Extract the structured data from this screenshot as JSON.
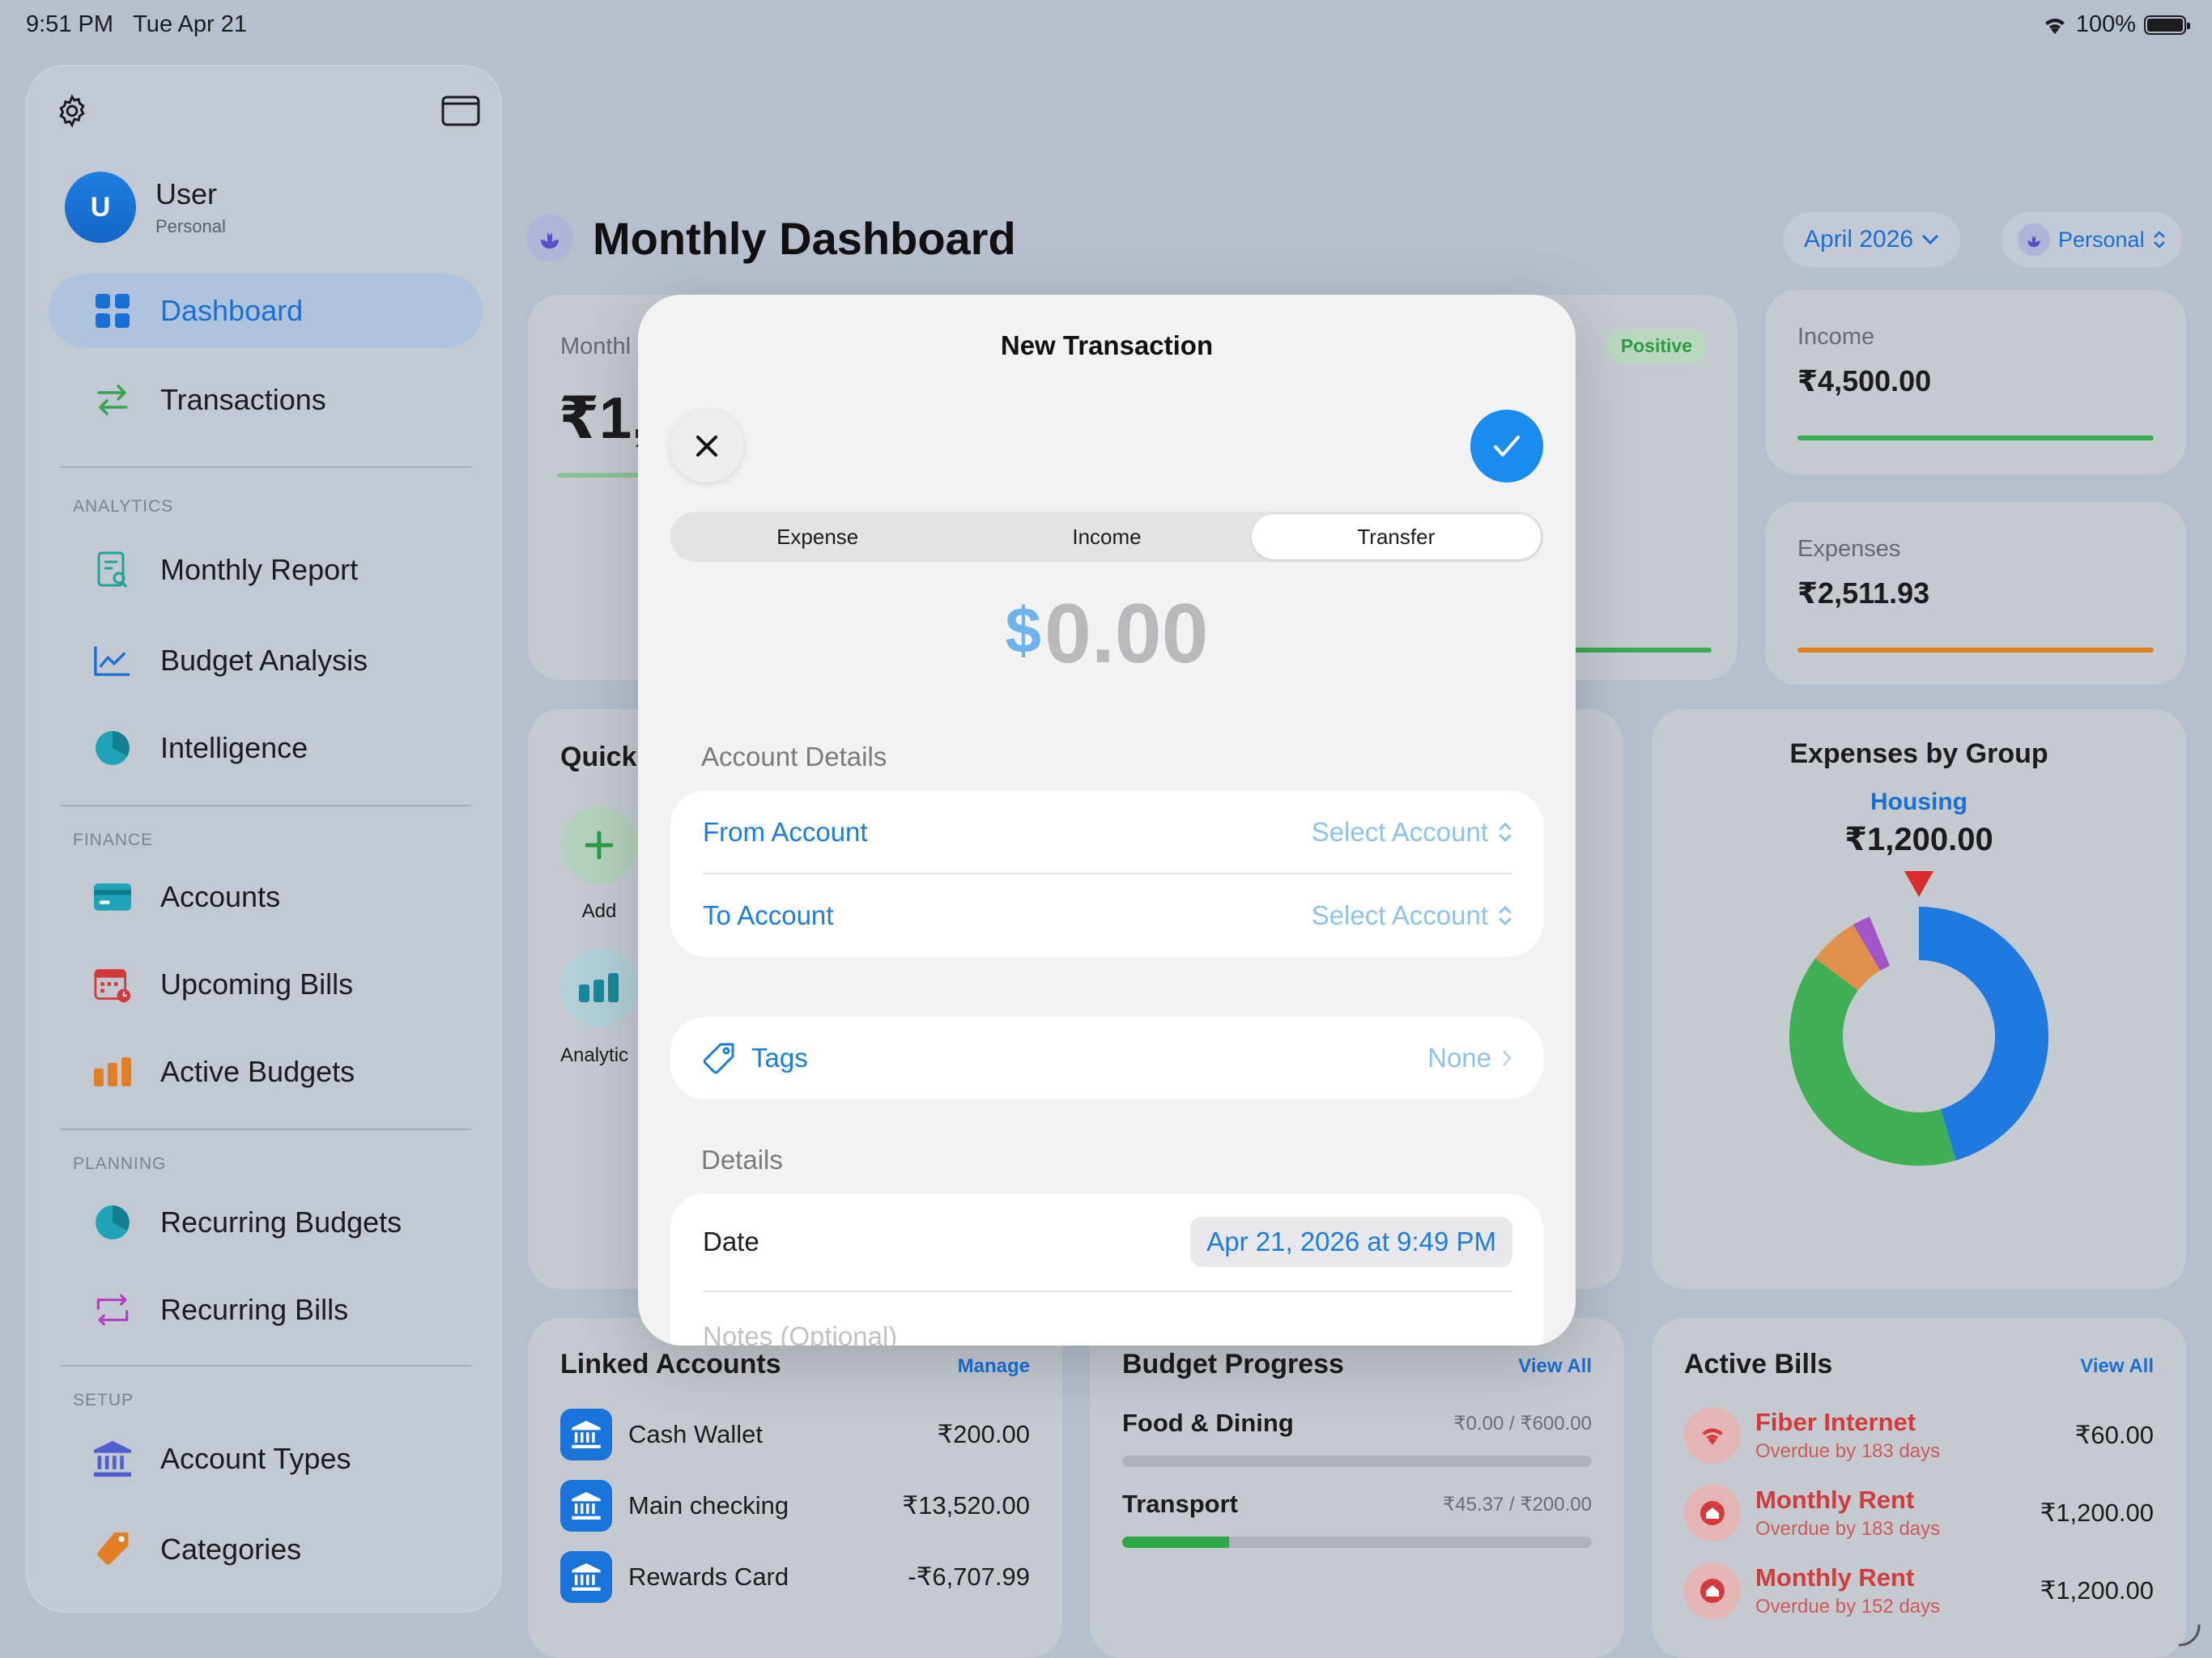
{
  "status_bar": {
    "time": "9:51 PM",
    "date": "Tue Apr 21",
    "battery": "100%"
  },
  "sidebar": {
    "user": {
      "initial": "U",
      "name": "User",
      "subtitle": "Personal"
    },
    "items": [
      {
        "label": "Dashboard",
        "icon": "grid-icon",
        "active": true
      },
      {
        "label": "Transactions",
        "icon": "arrows-swap-icon"
      }
    ],
    "sections": [
      {
        "title": "ANALYTICS",
        "items": [
          {
            "label": "Monthly Report",
            "icon": "report-icon"
          },
          {
            "label": "Budget Analysis",
            "icon": "line-chart-icon"
          },
          {
            "label": "Intelligence",
            "icon": "pie-icon"
          }
        ]
      },
      {
        "title": "FINANCE",
        "items": [
          {
            "label": "Accounts",
            "icon": "card-icon"
          },
          {
            "label": "Upcoming Bills",
            "icon": "calendar-icon"
          },
          {
            "label": "Active Budgets",
            "icon": "bar-chart-icon"
          }
        ]
      },
      {
        "title": "PLANNING",
        "items": [
          {
            "label": "Recurring Budgets",
            "icon": "pie-icon"
          },
          {
            "label": "Recurring Bills",
            "icon": "repeat-icon"
          }
        ]
      },
      {
        "title": "SETUP",
        "items": [
          {
            "label": "Account Types",
            "icon": "bank-icon"
          },
          {
            "label": "Categories",
            "icon": "tag-icon"
          }
        ]
      }
    ]
  },
  "header": {
    "title": "Monthly Dashboard",
    "month": "April 2026",
    "profile": "Personal"
  },
  "summary": {
    "card_label_partial": "Monthl",
    "card_value_partial": "₹1,",
    "badge": "Positive",
    "income_label": "Income",
    "income_value": "₹4,500.00",
    "expenses_label": "Expenses",
    "expenses_value": "₹2,511.93"
  },
  "quick": {
    "title_partial": "Quick",
    "add_label": "Add",
    "analytics_partial": "Analytic"
  },
  "expenses_by_group": {
    "title": "Expenses by Group",
    "selected_group": "Housing",
    "selected_value": "₹1,200.00",
    "colors": {
      "housing": "#1f7ae0",
      "green": "#3fae55",
      "orange": "#e0904a",
      "purple": "#a356c8"
    }
  },
  "linked_accounts": {
    "title": "Linked Accounts",
    "link": "Manage",
    "rows": [
      {
        "name": "Cash Wallet",
        "value": "₹200.00"
      },
      {
        "name": "Main checking",
        "value": "₹13,520.00"
      },
      {
        "name": "Rewards Card",
        "value": "-₹6,707.99"
      }
    ]
  },
  "budget_progress": {
    "title": "Budget Progress",
    "link": "View All",
    "rows": [
      {
        "name": "Food & Dining",
        "value": "₹0.00 / ₹600.00",
        "fraction": 0.0
      },
      {
        "name": "Transport",
        "value": "₹45.37 / ₹200.00",
        "fraction": 0.227
      }
    ]
  },
  "active_bills": {
    "title": "Active Bills",
    "link": "View All",
    "rows": [
      {
        "name": "Fiber Internet",
        "sub": "Overdue by 183 days",
        "value": "₹60.00",
        "icon": "wifi-icon"
      },
      {
        "name": "Monthly Rent",
        "sub": "Overdue by 183 days",
        "value": "₹1,200.00",
        "icon": "house-icon"
      },
      {
        "name": "Monthly Rent",
        "sub": "Overdue by 152 days",
        "value": "₹1,200.00",
        "icon": "house-icon"
      }
    ]
  },
  "modal": {
    "title": "New Transaction",
    "segments": [
      "Expense",
      "Income",
      "Transfer"
    ],
    "selected_segment": "Transfer",
    "currency": "$",
    "amount": "0.00",
    "account_section": "Account Details",
    "from_label": "From Account",
    "from_value": "Select Account",
    "to_label": "To Account",
    "to_value": "Select Account",
    "tags_label": "Tags",
    "tags_value": "None",
    "details_section": "Details",
    "date_label": "Date",
    "date_value": "Apr 21, 2026 at 9:49 PM",
    "notes_placeholder": "Notes (Optional)"
  }
}
